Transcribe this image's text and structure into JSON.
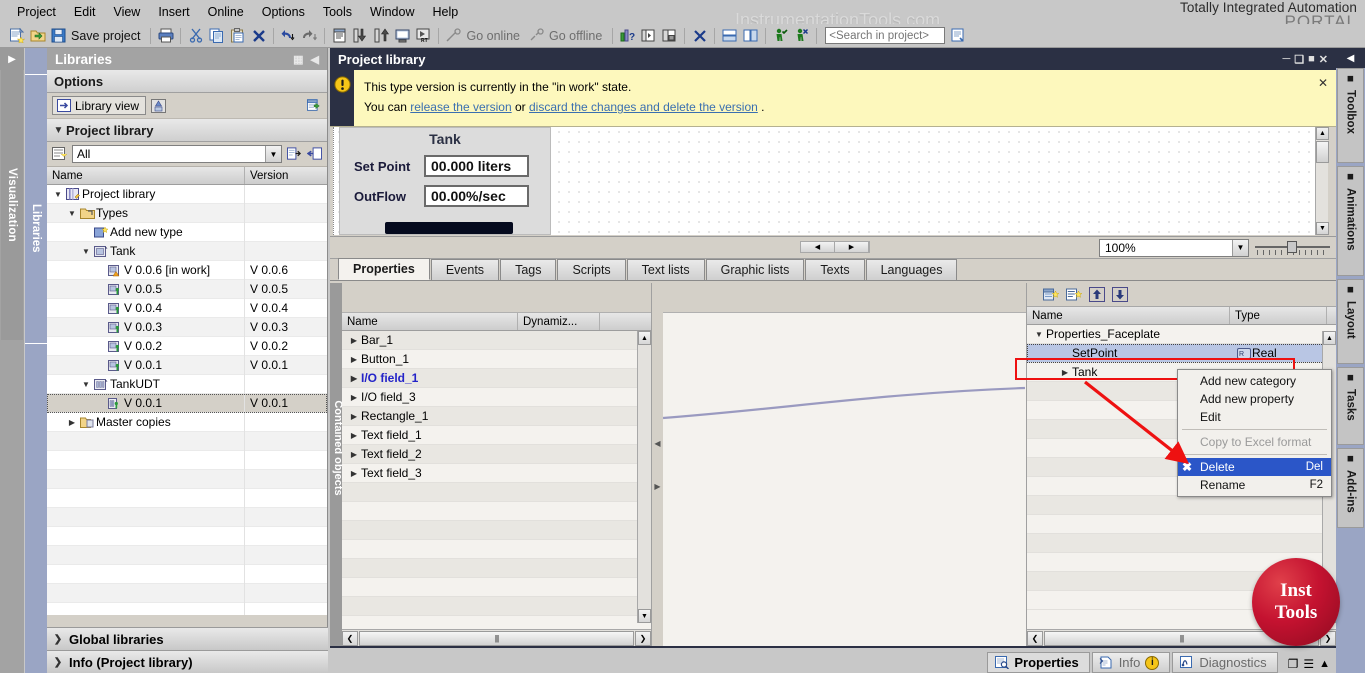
{
  "menu": {
    "items": [
      "Project",
      "Edit",
      "View",
      "Insert",
      "Online",
      "Options",
      "Tools",
      "Window",
      "Help"
    ]
  },
  "brand": {
    "line1": "Totally Integrated Automation",
    "line2": "PORTAL",
    "watermark": "InstrumentationTools.com"
  },
  "toolbar": {
    "new_project_icon": "new-project-icon",
    "open_project_icon": "open-project-icon",
    "save_icon": "save-icon",
    "save_label": "Save project",
    "print_icon": "print-icon",
    "cut_icon": "cut-icon",
    "copy_icon": "copy-icon",
    "paste_icon": "paste-icon",
    "delete_icon": "delete-icon",
    "undo_icon": "undo-icon",
    "redo_icon": "redo-icon",
    "compile_icon": "compile-icon",
    "download_icon": "download-icon",
    "upload_icon": "upload-icon",
    "simulation_icon": "start-simulation-icon",
    "rt_icon": "start-runtime-icon",
    "go_online_icon": "go-online-icon",
    "go_online_label": "Go online",
    "go_offline_icon": "go-offline-icon",
    "go_offline_label": "Go offline",
    "help_icon": "diagnostics-help-icon",
    "split_h_icon": "split-editor-horizontal-icon",
    "split_v_icon": "split-editor-vertical-icon",
    "close_editor_icon": "close-editor-icon",
    "arrange_h_icon": "arrange-horizontally-icon",
    "arrange_v_icon": "arrange-vertically-icon",
    "accept_icon": "accept-changes-icon",
    "reject_icon": "reject-changes-icon",
    "search_placeholder": "<Search in project>",
    "search_value": "",
    "search_go_icon": "search-go-icon"
  },
  "left_strips": {
    "visualization_tab": "Visualization",
    "libraries_tab": "Libraries",
    "expand_arrow": "▶"
  },
  "libraries": {
    "title": "Libraries",
    "restore_icon": "restore-window-icon",
    "collapse_icon": "collapse-panel-icon",
    "options_header": "Options",
    "library_view_label": "Library view",
    "library_view_icon": "library-view-icon",
    "compare_icon": "compare-libraries-icon",
    "export_icon": "export-library-icon",
    "project_library_header": "Project library",
    "filter_icon": "filter-icon",
    "filter_value": "All",
    "open_icon": "open-arrow-icon",
    "import_icon": "import-arrow-icon",
    "columns": [
      "Name",
      "Version"
    ],
    "tree": [
      {
        "label": "Project library",
        "version": "",
        "indent": 0,
        "expander": "▼",
        "icon": "project-library-icon",
        "selected": false
      },
      {
        "label": "Types",
        "version": "",
        "indent": 1,
        "expander": "▼",
        "icon": "types-folder-icon",
        "selected": false
      },
      {
        "label": "Add new type",
        "version": "",
        "indent": 2,
        "expander": "",
        "icon": "add-new-type-icon",
        "selected": false
      },
      {
        "label": "Tank",
        "version": "",
        "indent": 2,
        "expander": "▼",
        "icon": "type-icon",
        "selected": false
      },
      {
        "label": "V 0.0.6 [in work]",
        "version": "V 0.0.6",
        "indent": 3,
        "expander": "",
        "icon": "type-version-inwork-icon",
        "selected": false
      },
      {
        "label": "V 0.0.5",
        "version": "V 0.0.5",
        "indent": 3,
        "expander": "",
        "icon": "type-version-released-icon",
        "selected": false
      },
      {
        "label": "V 0.0.4",
        "version": "V 0.0.4",
        "indent": 3,
        "expander": "",
        "icon": "type-version-released-icon",
        "selected": false
      },
      {
        "label": "V 0.0.3",
        "version": "V 0.0.3",
        "indent": 3,
        "expander": "",
        "icon": "type-version-released-icon",
        "selected": false
      },
      {
        "label": "V 0.0.2",
        "version": "V 0.0.2",
        "indent": 3,
        "expander": "",
        "icon": "type-version-released-icon",
        "selected": false
      },
      {
        "label": "V 0.0.1",
        "version": "V 0.0.1",
        "indent": 3,
        "expander": "",
        "icon": "type-version-released-icon",
        "selected": false
      },
      {
        "label": "TankUDT",
        "version": "",
        "indent": 2,
        "expander": "▼",
        "icon": "udt-icon",
        "selected": false
      },
      {
        "label": "V 0.0.1",
        "version": "V 0.0.1",
        "indent": 3,
        "expander": "",
        "icon": "udt-version-icon",
        "selected": true
      },
      {
        "label": "Master copies",
        "version": "",
        "indent": 1,
        "expander": "▶",
        "icon": "master-copies-folder-icon",
        "selected": false
      }
    ],
    "global_libraries_header": "Global libraries",
    "info_header": "Info (Project library)"
  },
  "editor": {
    "title": "Project library",
    "window_controls": [
      "minimize",
      "restore",
      "maximize",
      "close"
    ],
    "notice": {
      "icon": "warning-icon",
      "line1": "This type version is currently in the \"in work\" state.",
      "line2_prefix": "You can ",
      "link1": "release the version",
      "line2_mid": " or ",
      "link2": "discard the changes and delete the version",
      "line2_suffix": " .",
      "close_icon": "close-notice-icon"
    },
    "faceplate": {
      "title": "Tank",
      "rows": [
        {
          "label": "Set Point",
          "value": "00.000 liters"
        },
        {
          "label": "OutFlow",
          "value": "00.00%/sec"
        }
      ]
    },
    "zoom": {
      "value": "100%",
      "dropdown_icon": "chevron-down-icon",
      "slider_icon": "zoom-slider"
    },
    "tabs": [
      {
        "label": "Properties",
        "active": true
      },
      {
        "label": "Events",
        "active": false
      },
      {
        "label": "Tags",
        "active": false
      },
      {
        "label": "Scripts",
        "active": false
      },
      {
        "label": "Text lists",
        "active": false
      },
      {
        "label": "Graphic lists",
        "active": false
      },
      {
        "label": "Texts",
        "active": false
      },
      {
        "label": "Languages",
        "active": false
      }
    ]
  },
  "contained_objects": {
    "side_label": "Contained objects",
    "columns": [
      "Name",
      "Dynamiz..."
    ],
    "rows": [
      {
        "name": "Bar_1",
        "highlight": false
      },
      {
        "name": "Button_1",
        "highlight": false
      },
      {
        "name": "I/O field_1",
        "highlight": true
      },
      {
        "name": "I/O field_3",
        "highlight": false
      },
      {
        "name": "Rectangle_1",
        "highlight": false
      },
      {
        "name": "Text field_1",
        "highlight": false
      },
      {
        "name": "Text field_2",
        "highlight": false
      },
      {
        "name": "Text field_3",
        "highlight": false
      }
    ],
    "expander_icon": "▶"
  },
  "interface": {
    "toolbar_icons": [
      "add-new-category-icon",
      "add-new-property-icon",
      "move-up-icon",
      "move-down-icon"
    ],
    "columns": [
      "Name",
      "Type"
    ],
    "rows": [
      {
        "name": "Properties_Faceplate",
        "type": "",
        "indent": 0,
        "expander": "▼",
        "selected": false
      },
      {
        "name": "SetPoint",
        "type": "Real",
        "indent": 1,
        "expander": "",
        "selected": true,
        "type_icon": "real-datatype-icon"
      },
      {
        "name": "Tank",
        "type": "",
        "indent": 1,
        "expander": "▶",
        "selected": false
      }
    ]
  },
  "context_menu": {
    "items": [
      {
        "label": "Add new category",
        "shortcut": "",
        "state": "normal",
        "icon": ""
      },
      {
        "label": "Add new property",
        "shortcut": "",
        "state": "normal",
        "icon": ""
      },
      {
        "label": "Edit",
        "shortcut": "",
        "state": "normal",
        "icon": ""
      },
      {
        "label": "Copy to Excel format",
        "shortcut": "",
        "state": "disabled",
        "icon": "",
        "separator_before": true
      },
      {
        "label": "Delete",
        "shortcut": "Del",
        "state": "highlighted",
        "icon": "delete-x-icon",
        "separator_before": true
      },
      {
        "label": "Rename",
        "shortcut": "F2",
        "state": "normal",
        "icon": ""
      }
    ]
  },
  "right_strips": {
    "collapse_icon": "collapse-right-icon",
    "tabs": [
      {
        "label": "Toolbox",
        "icon": "toolbox-icon"
      },
      {
        "label": "Animations",
        "icon": "animations-icon"
      },
      {
        "label": "Layout",
        "icon": "layout-icon"
      },
      {
        "label": "Tasks",
        "icon": "tasks-icon"
      },
      {
        "label": "Add-ins",
        "icon": "addins-icon"
      }
    ]
  },
  "logo": {
    "line1": "Inst",
    "line2": "Tools"
  },
  "statusbar": {
    "tabs": [
      {
        "label": "Properties",
        "icon": "properties-icon",
        "active": true,
        "badge": ""
      },
      {
        "label": "Info",
        "icon": "info-icon",
        "active": false,
        "badge": "i"
      },
      {
        "label": "Diagnostics",
        "icon": "diagnostics-icon",
        "active": false,
        "badge": ""
      }
    ],
    "corner_icons": [
      "restore-pane-icon",
      "expand-pane-icon",
      "collapse-up-icon"
    ]
  },
  "colors": {
    "accent_dark": "#2b3044",
    "notice_bg": "#fdf8bd",
    "highlight_red": "#ee1111",
    "menu_highlight": "#2b56c8",
    "link": "#3a6fb0",
    "logo_red": "#c41230"
  }
}
